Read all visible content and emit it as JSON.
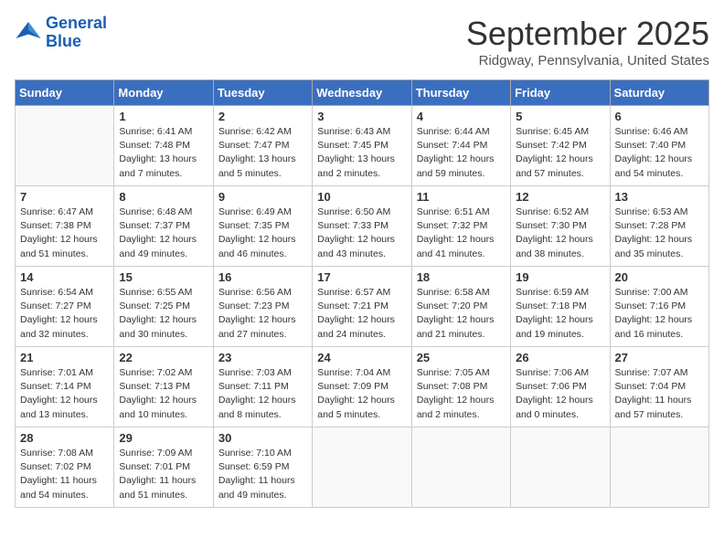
{
  "header": {
    "logo_line1": "General",
    "logo_line2": "Blue",
    "month": "September 2025",
    "location": "Ridgway, Pennsylvania, United States"
  },
  "weekdays": [
    "Sunday",
    "Monday",
    "Tuesday",
    "Wednesday",
    "Thursday",
    "Friday",
    "Saturday"
  ],
  "weeks": [
    [
      {
        "day": "",
        "info": ""
      },
      {
        "day": "1",
        "info": "Sunrise: 6:41 AM\nSunset: 7:48 PM\nDaylight: 13 hours\nand 7 minutes."
      },
      {
        "day": "2",
        "info": "Sunrise: 6:42 AM\nSunset: 7:47 PM\nDaylight: 13 hours\nand 5 minutes."
      },
      {
        "day": "3",
        "info": "Sunrise: 6:43 AM\nSunset: 7:45 PM\nDaylight: 13 hours\nand 2 minutes."
      },
      {
        "day": "4",
        "info": "Sunrise: 6:44 AM\nSunset: 7:44 PM\nDaylight: 12 hours\nand 59 minutes."
      },
      {
        "day": "5",
        "info": "Sunrise: 6:45 AM\nSunset: 7:42 PM\nDaylight: 12 hours\nand 57 minutes."
      },
      {
        "day": "6",
        "info": "Sunrise: 6:46 AM\nSunset: 7:40 PM\nDaylight: 12 hours\nand 54 minutes."
      }
    ],
    [
      {
        "day": "7",
        "info": "Sunrise: 6:47 AM\nSunset: 7:38 PM\nDaylight: 12 hours\nand 51 minutes."
      },
      {
        "day": "8",
        "info": "Sunrise: 6:48 AM\nSunset: 7:37 PM\nDaylight: 12 hours\nand 49 minutes."
      },
      {
        "day": "9",
        "info": "Sunrise: 6:49 AM\nSunset: 7:35 PM\nDaylight: 12 hours\nand 46 minutes."
      },
      {
        "day": "10",
        "info": "Sunrise: 6:50 AM\nSunset: 7:33 PM\nDaylight: 12 hours\nand 43 minutes."
      },
      {
        "day": "11",
        "info": "Sunrise: 6:51 AM\nSunset: 7:32 PM\nDaylight: 12 hours\nand 41 minutes."
      },
      {
        "day": "12",
        "info": "Sunrise: 6:52 AM\nSunset: 7:30 PM\nDaylight: 12 hours\nand 38 minutes."
      },
      {
        "day": "13",
        "info": "Sunrise: 6:53 AM\nSunset: 7:28 PM\nDaylight: 12 hours\nand 35 minutes."
      }
    ],
    [
      {
        "day": "14",
        "info": "Sunrise: 6:54 AM\nSunset: 7:27 PM\nDaylight: 12 hours\nand 32 minutes."
      },
      {
        "day": "15",
        "info": "Sunrise: 6:55 AM\nSunset: 7:25 PM\nDaylight: 12 hours\nand 30 minutes."
      },
      {
        "day": "16",
        "info": "Sunrise: 6:56 AM\nSunset: 7:23 PM\nDaylight: 12 hours\nand 27 minutes."
      },
      {
        "day": "17",
        "info": "Sunrise: 6:57 AM\nSunset: 7:21 PM\nDaylight: 12 hours\nand 24 minutes."
      },
      {
        "day": "18",
        "info": "Sunrise: 6:58 AM\nSunset: 7:20 PM\nDaylight: 12 hours\nand 21 minutes."
      },
      {
        "day": "19",
        "info": "Sunrise: 6:59 AM\nSunset: 7:18 PM\nDaylight: 12 hours\nand 19 minutes."
      },
      {
        "day": "20",
        "info": "Sunrise: 7:00 AM\nSunset: 7:16 PM\nDaylight: 12 hours\nand 16 minutes."
      }
    ],
    [
      {
        "day": "21",
        "info": "Sunrise: 7:01 AM\nSunset: 7:14 PM\nDaylight: 12 hours\nand 13 minutes."
      },
      {
        "day": "22",
        "info": "Sunrise: 7:02 AM\nSunset: 7:13 PM\nDaylight: 12 hours\nand 10 minutes."
      },
      {
        "day": "23",
        "info": "Sunrise: 7:03 AM\nSunset: 7:11 PM\nDaylight: 12 hours\nand 8 minutes."
      },
      {
        "day": "24",
        "info": "Sunrise: 7:04 AM\nSunset: 7:09 PM\nDaylight: 12 hours\nand 5 minutes."
      },
      {
        "day": "25",
        "info": "Sunrise: 7:05 AM\nSunset: 7:08 PM\nDaylight: 12 hours\nand 2 minutes."
      },
      {
        "day": "26",
        "info": "Sunrise: 7:06 AM\nSunset: 7:06 PM\nDaylight: 12 hours\nand 0 minutes."
      },
      {
        "day": "27",
        "info": "Sunrise: 7:07 AM\nSunset: 7:04 PM\nDaylight: 11 hours\nand 57 minutes."
      }
    ],
    [
      {
        "day": "28",
        "info": "Sunrise: 7:08 AM\nSunset: 7:02 PM\nDaylight: 11 hours\nand 54 minutes."
      },
      {
        "day": "29",
        "info": "Sunrise: 7:09 AM\nSunset: 7:01 PM\nDaylight: 11 hours\nand 51 minutes."
      },
      {
        "day": "30",
        "info": "Sunrise: 7:10 AM\nSunset: 6:59 PM\nDaylight: 11 hours\nand 49 minutes."
      },
      {
        "day": "",
        "info": ""
      },
      {
        "day": "",
        "info": ""
      },
      {
        "day": "",
        "info": ""
      },
      {
        "day": "",
        "info": ""
      }
    ]
  ]
}
